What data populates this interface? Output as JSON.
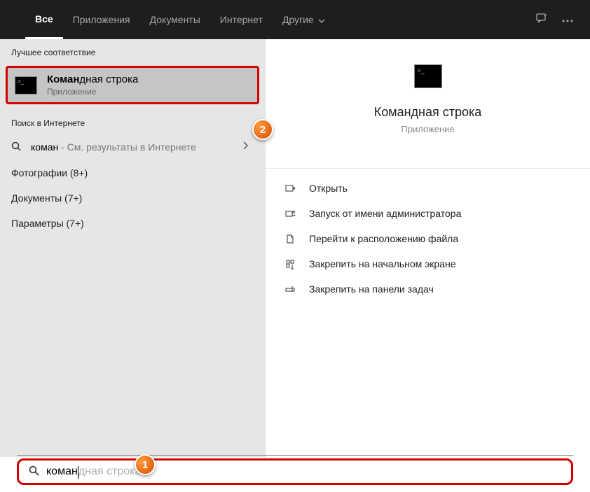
{
  "tabs": {
    "all": "Все",
    "apps": "Приложения",
    "docs": "Документы",
    "web": "Интернет",
    "more": "Другие"
  },
  "left": {
    "best_match_header": "Лучшее соответствие",
    "best_match": {
      "title_bold": "Коман",
      "title_rest": "дная строка",
      "subtitle": "Приложение"
    },
    "web_header": "Поиск в Интернете",
    "web_result": {
      "query": "коман",
      "hint": " - См. результаты в Интернете"
    },
    "categories": {
      "photos": "Фотографии (8+)",
      "documents": "Документы (7+)",
      "settings": "Параметры (7+)"
    }
  },
  "right": {
    "title": "Командная строка",
    "subtitle": "Приложение",
    "actions": {
      "open": "Открыть",
      "admin": "Запуск от имени администратора",
      "location": "Перейти к расположению файла",
      "pin_start": "Закрепить на начальном экране",
      "pin_taskbar": "Закрепить на панели задач"
    }
  },
  "search": {
    "typed": "коман",
    "completion": "дная строка"
  },
  "annotations": {
    "one": "1",
    "two": "2"
  }
}
